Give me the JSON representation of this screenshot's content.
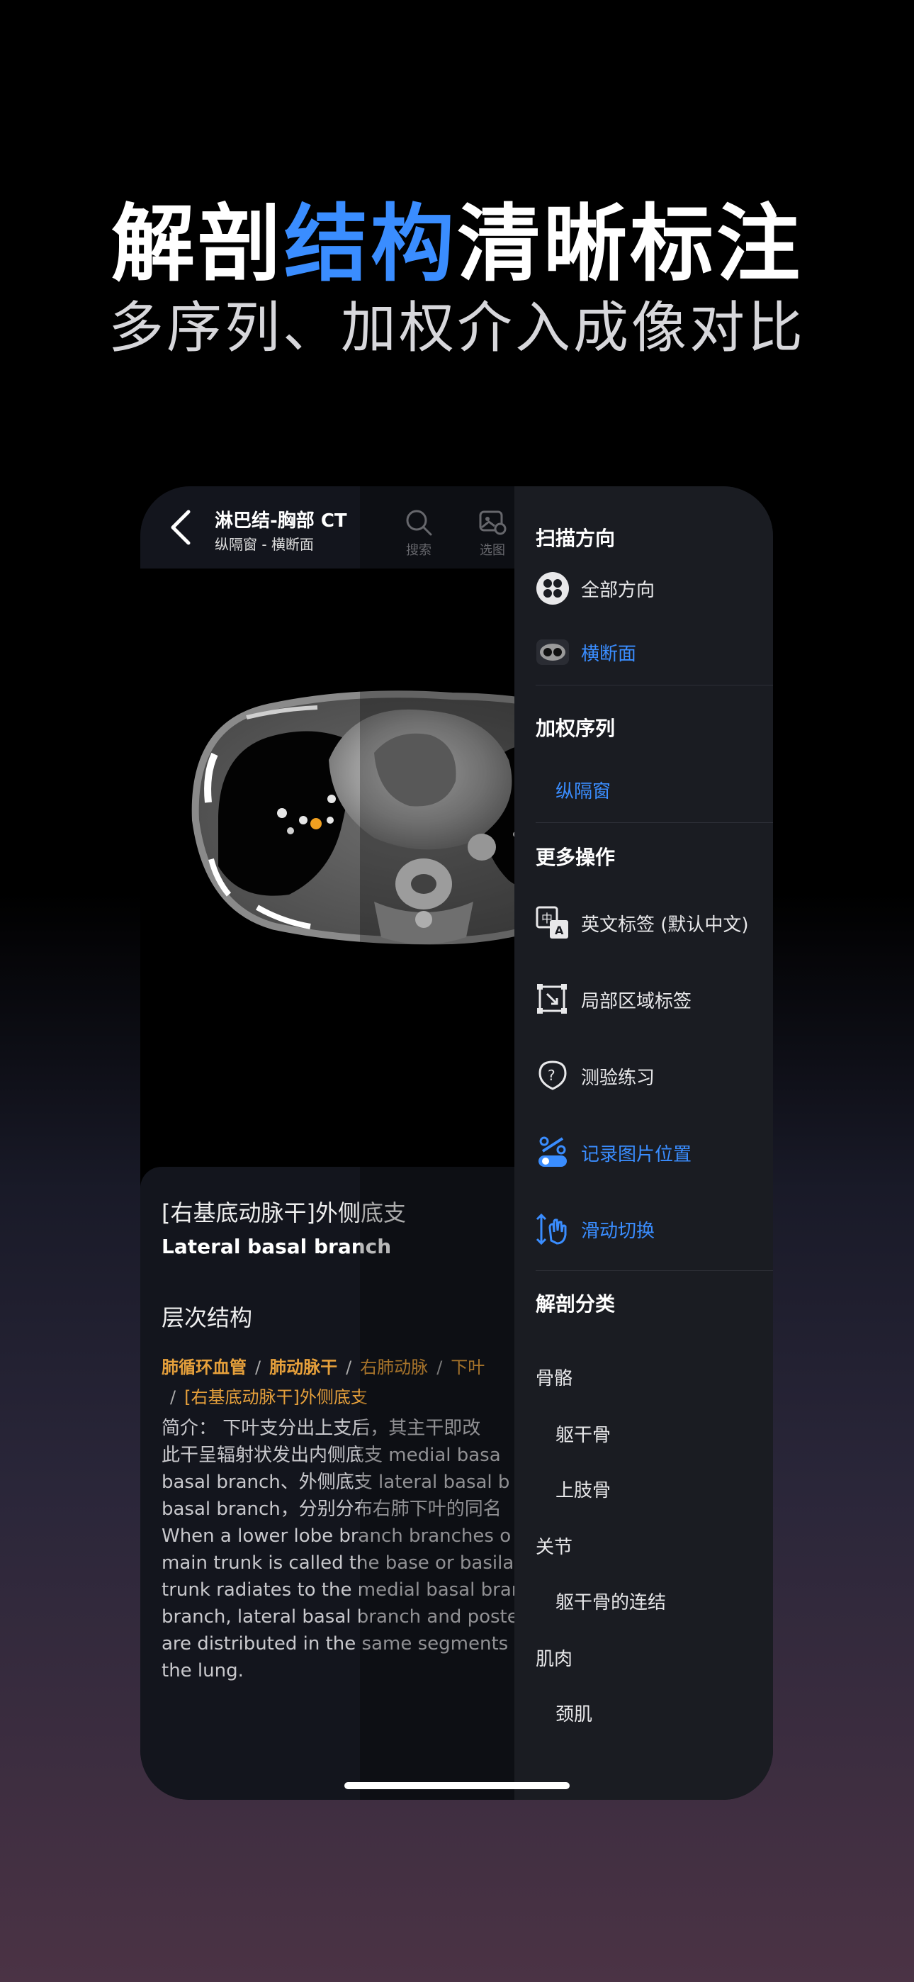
{
  "headline": {
    "part1": "解剖",
    "accent": "结构",
    "part2": "清晰标注"
  },
  "subheadline": "多序列、加权介入成像对比",
  "nav": {
    "title": "淋巴结-胸部 CT",
    "subtitle": "纵隔窗 - 横断面",
    "tools": [
      {
        "label": "搜索",
        "icon": "search-icon"
      },
      {
        "label": "选图",
        "icon": "image-select-icon"
      }
    ]
  },
  "info": {
    "title": "[右基底动脉干]外侧底支",
    "title_en": "Lateral basal branch",
    "section": "层次结构",
    "crumbs": [
      "肺循环血管",
      "肺动脉干",
      "右肺动脉",
      "下叶",
      "[右基底动脉干]外侧底支"
    ],
    "crumb_sep": "/",
    "desc_lines": [
      "简介：  下叶支分出上支后，其主干即改",
      "此干呈辐射状发出内侧底支 medial basa",
      "basal branch、外侧底支 lateral basal b",
      "basal branch，分别分布右肺下叶的同名",
      " When a lower lobe branch branches o",
      "main trunk is called the base or basilar",
      "trunk radiates to the medial basal bran",
      "branch, lateral basal branch and poste",
      "are distributed in the same segments o",
      "the lung."
    ]
  },
  "panel": {
    "scan_title": "扫描方向",
    "scan_items": [
      {
        "label": "全部方向",
        "icon": "all-directions-icon",
        "active": false
      },
      {
        "label": "横断面",
        "icon": "axial-thumbnail-icon",
        "active": true
      }
    ],
    "weight_title": "加权序列",
    "weight_items": [
      "纵隔窗"
    ],
    "more_title": "更多操作",
    "more_items": [
      {
        "label": "英文标签 (默认中文)",
        "icon": "translate-icon",
        "active": false
      },
      {
        "label": "局部区域标签",
        "icon": "region-select-icon",
        "active": false
      },
      {
        "label": "测验练习",
        "icon": "quiz-icon",
        "active": false
      },
      {
        "label": "记录图片位置",
        "icon": "record-position-icon",
        "active": true
      },
      {
        "label": "滑动切换",
        "icon": "swipe-switch-icon",
        "active": true
      }
    ],
    "category_title": "解剖分类",
    "categories": [
      {
        "label": "骨骼",
        "level": 0
      },
      {
        "label": "躯干骨",
        "level": 1
      },
      {
        "label": "上肢骨",
        "level": 1
      },
      {
        "label": "关节",
        "level": 0
      },
      {
        "label": "躯干骨的连结",
        "level": 1
      },
      {
        "label": "肌肉",
        "level": 0
      },
      {
        "label": "颈肌",
        "level": 1
      }
    ]
  },
  "colors": {
    "accent": "#3a8dff",
    "crumb": "#e6a03b",
    "marker": "#f0a020"
  }
}
